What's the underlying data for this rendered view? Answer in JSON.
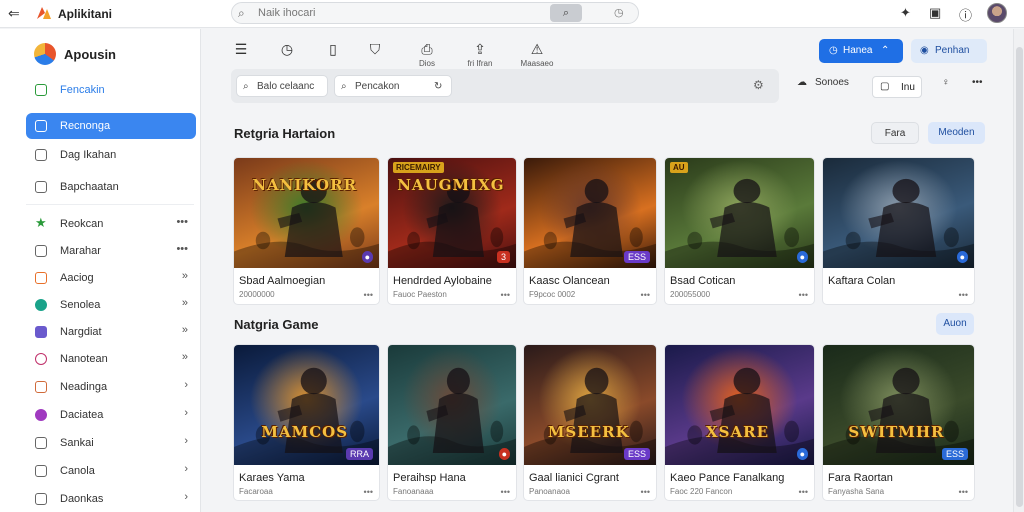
{
  "topbar": {
    "back_icon": "back-arrow-icon",
    "app_title": "Aplikitani",
    "search_placeholder": "Naik ihocari",
    "icons": [
      "pin-icon",
      "window-icon",
      "info-icon"
    ]
  },
  "sidebar": {
    "brand": "Apousin",
    "items": [
      {
        "label": "Fencakin",
        "icon": "grid-icon",
        "tail": ""
      },
      {
        "label": "Recnonga",
        "icon": "square-icon",
        "tail": ""
      },
      {
        "label": "Dag Ikahan",
        "icon": "circle-icon",
        "tail": ""
      },
      {
        "label": "Bapchaatan",
        "icon": "folder-icon",
        "tail": ""
      },
      {
        "label": "Reokcan",
        "icon": "star-icon",
        "tail": "•••"
      },
      {
        "label": "Marahar",
        "icon": "grid-icon",
        "tail": "•••"
      },
      {
        "label": "Aaciog",
        "icon": "tag-icon",
        "tail": "»"
      },
      {
        "label": "Senolea",
        "icon": "dot-icon",
        "tail": "»"
      },
      {
        "label": "Nargdiat",
        "icon": "badge-icon",
        "tail": "»"
      },
      {
        "label": "Nanotean",
        "icon": "record-icon",
        "tail": "»"
      },
      {
        "label": "Neadinga",
        "icon": "square-icon",
        "tail": "›"
      },
      {
        "label": "Daciatea",
        "icon": "dot-icon",
        "tail": "›"
      },
      {
        "label": "Sankai",
        "icon": "leaf-icon",
        "tail": "›"
      },
      {
        "label": "Canola",
        "icon": "square-icon",
        "tail": "›"
      },
      {
        "label": "Daonkas",
        "icon": "leaf-icon",
        "tail": "›"
      }
    ]
  },
  "toolbar": {
    "tools": [
      {
        "icon": "list-icon",
        "label": ""
      },
      {
        "icon": "clock-icon",
        "label": ""
      },
      {
        "icon": "file-icon",
        "label": ""
      },
      {
        "icon": "shield-icon",
        "label": ""
      },
      {
        "icon": "printer-icon",
        "label": "Dios"
      },
      {
        "icon": "share-icon",
        "label": "fri Ifran"
      },
      {
        "icon": "alert-icon",
        "label": "Maasaeo"
      }
    ],
    "primary_button": "Hanea",
    "secondary_button": "Penhan"
  },
  "filter": {
    "input1": "Balo celaanc",
    "input2": "Pencakon",
    "sort_label": "Sonoes",
    "box_label": "Inu"
  },
  "sections": [
    {
      "title": "Retgria Hartaion",
      "buttons": [
        "Fara",
        "Meoden"
      ],
      "cards": [
        {
          "name": "Sbad Aalmoegian",
          "sub": "20000000",
          "badge": "",
          "game_title": "NANIKORR",
          "tag": "",
          "colors": [
            "#7a3a1a",
            "#d9802a",
            "#3c7a2a"
          ]
        },
        {
          "name": "Hendrded Aylobaine",
          "sub": "Fauoc Paeston",
          "badge": "3",
          "game_title": "NAUGMIXG",
          "tag": "RICEMAIRY",
          "colors": [
            "#4a1010",
            "#a02a1a",
            "#201a1a"
          ]
        },
        {
          "name": "Kaasc Olancean",
          "sub": "F9pcoc 0002",
          "badge": "ESS",
          "game_title": "",
          "tag": "",
          "colors": [
            "#3a1a0a",
            "#d87020",
            "#6a3a2a"
          ]
        },
        {
          "name": "Bsad Cotican",
          "sub": "200055000",
          "badge": "",
          "game_title": "",
          "tag": "AU",
          "colors": [
            "#2a3a1a",
            "#5a7a3a",
            "#8aa05a"
          ]
        },
        {
          "name": "Kaftara Colan",
          "sub": "",
          "badge": "",
          "game_title": "",
          "tag": "",
          "colors": [
            "#1a2a3a",
            "#3a5a7a",
            "#8a9aaa"
          ]
        }
      ]
    },
    {
      "title": "Natgria Game",
      "buttons": [
        "Auon"
      ],
      "cards": [
        {
          "name": "Karaes Yama",
          "sub": "Facaroaa",
          "badge": "RRA",
          "game_title": "MAMCOS",
          "tag": "",
          "colors": [
            "#0a1a3a",
            "#2a4a8a",
            "#d89030"
          ]
        },
        {
          "name": "Peraihsp Hana",
          "sub": "Fanoanaaa",
          "badge": "",
          "game_title": "",
          "tag": "",
          "colors": [
            "#1a3a3a",
            "#3a6a6a",
            "#6a4a3a"
          ]
        },
        {
          "name": "Gaal lianici Cgrant",
          "sub": "Panoanaoa",
          "badge": "ESS",
          "game_title": "MSEERK",
          "tag": "",
          "colors": [
            "#2a1a1a",
            "#8a4a2a",
            "#d8a040"
          ]
        },
        {
          "name": "Kaeo Pance Fanalkang",
          "sub": "Faoc 220 Fancon",
          "badge": "",
          "game_title": "XSARE",
          "tag": "",
          "colors": [
            "#1a1a4a",
            "#5a3a8a",
            "#e06020"
          ]
        },
        {
          "name": "Fara Raortan",
          "sub": "Fanyasha Sana",
          "badge": "ESS",
          "game_title": "SWITMHR",
          "tag": "",
          "colors": [
            "#1a2a1a",
            "#3a4a2a",
            "#7a8a5a"
          ]
        }
      ]
    }
  ]
}
